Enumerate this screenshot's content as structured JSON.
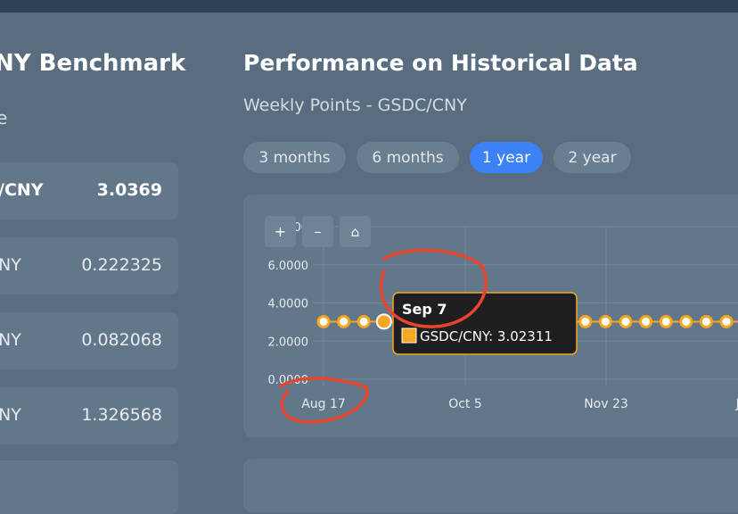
{
  "sidebar": {
    "title": "NY Benchmark",
    "subtitle": "e",
    "pairs": [
      {
        "name": "/CNY",
        "value": "3.0369"
      },
      {
        "name": "NY",
        "value": "0.222325"
      },
      {
        "name": "NY",
        "value": "0.082068"
      },
      {
        "name": "NY",
        "value": "1.326568"
      }
    ]
  },
  "main": {
    "title": "Performance on Historical Data",
    "subtitle": "Weekly Points - GSDC/CNY",
    "ranges": [
      "3 months",
      "6 months",
      "1 year",
      "2 year"
    ],
    "active_range": "1 year",
    "zoom_in": "+",
    "zoom_out": "–",
    "home": "⌂"
  },
  "colors": {
    "accent": "#3b82f6",
    "marker": "#f5a623",
    "annotation": "#e8452c"
  },
  "chart_data": {
    "type": "line",
    "series": [
      {
        "name": "GSDC/CNY",
        "values": [
          3.02,
          3.02,
          3.02,
          3.02311,
          3.02,
          3.02,
          3.02,
          3.02,
          3.02,
          3.02,
          3.02,
          3.02,
          3.02,
          3.02,
          3.02,
          3.02,
          3.02,
          3.02,
          3.02,
          3.02,
          3.02,
          3.02
        ]
      }
    ],
    "x_tick_labels": [
      "Aug 17",
      "Oct 5",
      "Nov 23",
      "Ja"
    ],
    "y_tick_labels": [
      "0.0000",
      "2.0000",
      "4.0000",
      "6.0000",
      "8.0000"
    ],
    "ylim": [
      0,
      8
    ],
    "grid": true,
    "tooltip": {
      "title": "Sep 7",
      "label": "GSDC/CNY: 3.02311"
    }
  }
}
